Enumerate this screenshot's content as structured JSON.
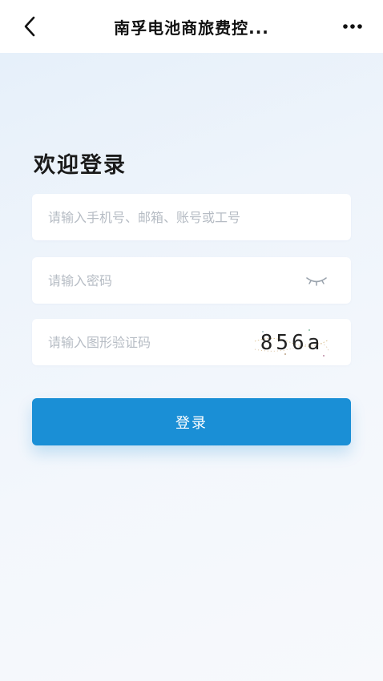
{
  "header": {
    "title": "南孚电池商旅费控...",
    "back_icon": "chevron-left-icon",
    "more_icon": "more-horizontal-icon"
  },
  "login": {
    "welcome": "欢迎登录",
    "account_placeholder": "请输入手机号、邮箱、账号或工号",
    "password_placeholder": "请输入密码",
    "captcha_placeholder": "请输入图形验证码",
    "captcha_text": "856a",
    "button_label": "登录"
  },
  "colors": {
    "primary": "#1a8fd6",
    "background_tint": "#e6f0fa"
  }
}
